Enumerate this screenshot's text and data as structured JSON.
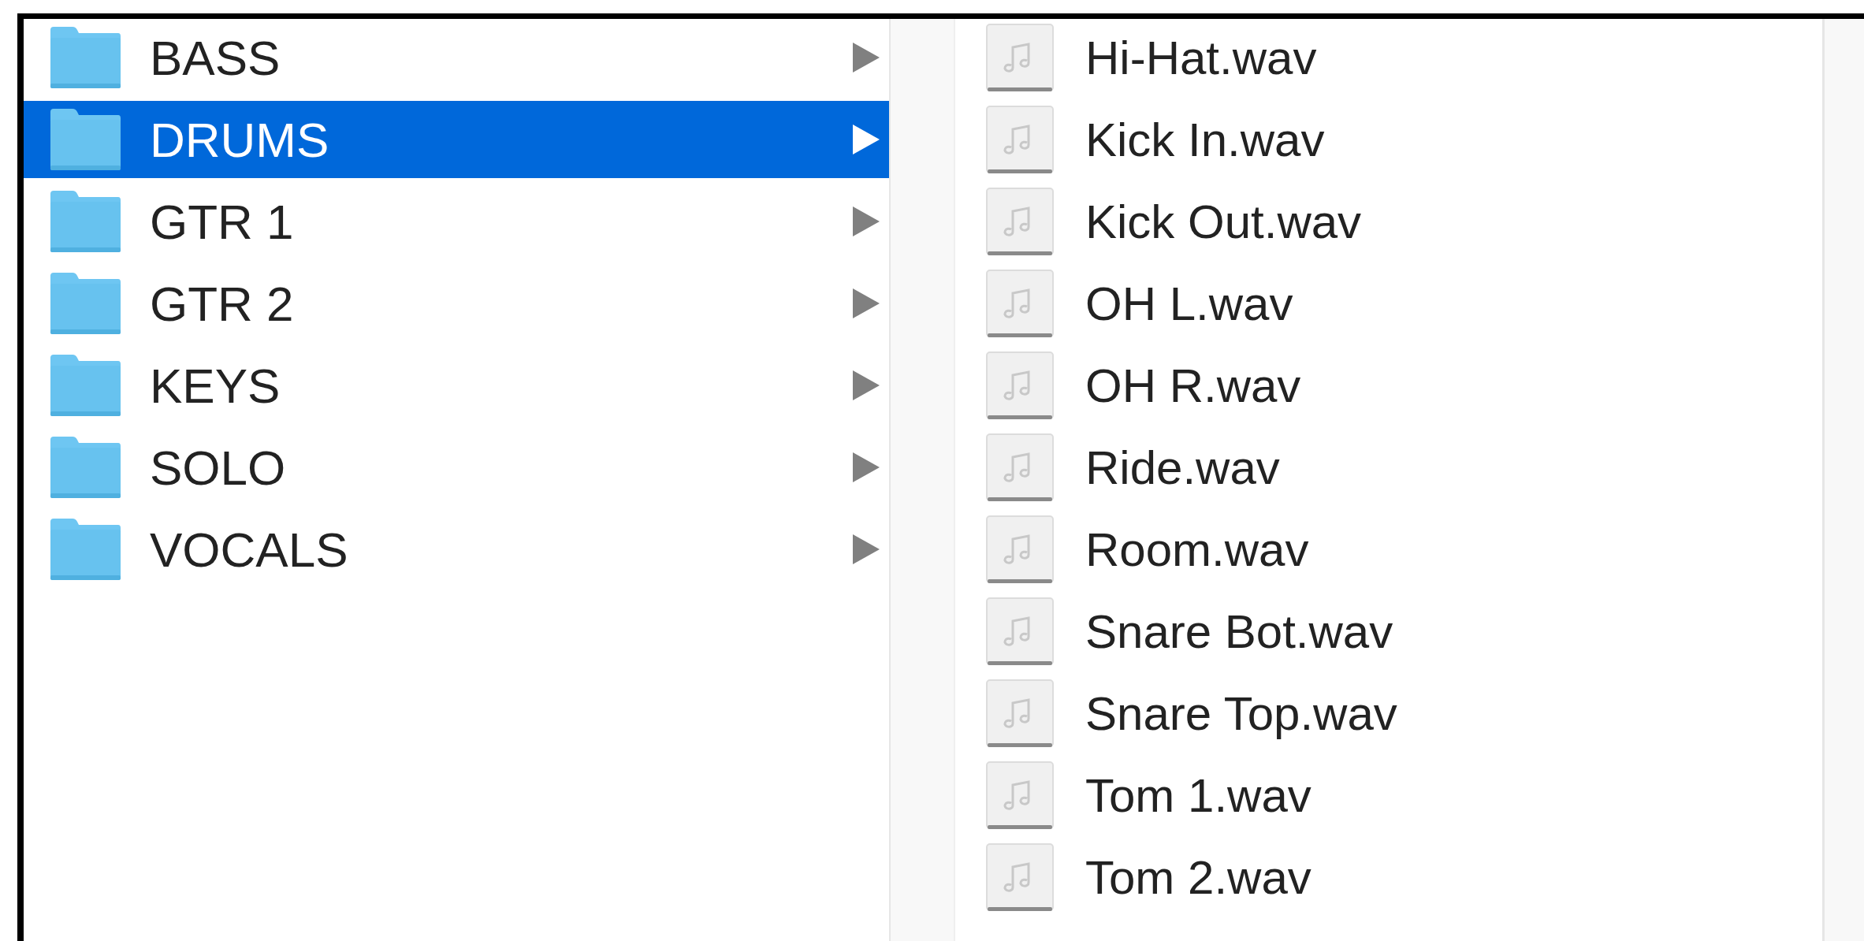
{
  "folders": [
    {
      "name": "BASS",
      "selected": false
    },
    {
      "name": "DRUMS",
      "selected": true
    },
    {
      "name": "GTR 1",
      "selected": false
    },
    {
      "name": "GTR 2",
      "selected": false
    },
    {
      "name": "KEYS",
      "selected": false
    },
    {
      "name": "SOLO",
      "selected": false
    },
    {
      "name": "VOCALS",
      "selected": false
    }
  ],
  "files": [
    {
      "name": "Hi-Hat.wav",
      "selected": false
    },
    {
      "name": "Kick In.wav",
      "selected": false
    },
    {
      "name": "Kick Out.wav",
      "selected": false
    },
    {
      "name": "OH L.wav",
      "selected": false
    },
    {
      "name": "OH R.wav",
      "selected": false
    },
    {
      "name": "Ride.wav",
      "selected": false
    },
    {
      "name": "Room.wav",
      "selected": false
    },
    {
      "name": "Snare Bot.wav",
      "selected": false
    },
    {
      "name": "Snare Top.wav",
      "selected": false
    },
    {
      "name": "Tom 1.wav",
      "selected": false
    },
    {
      "name": "Tom 2.wav",
      "selected": false
    }
  ]
}
